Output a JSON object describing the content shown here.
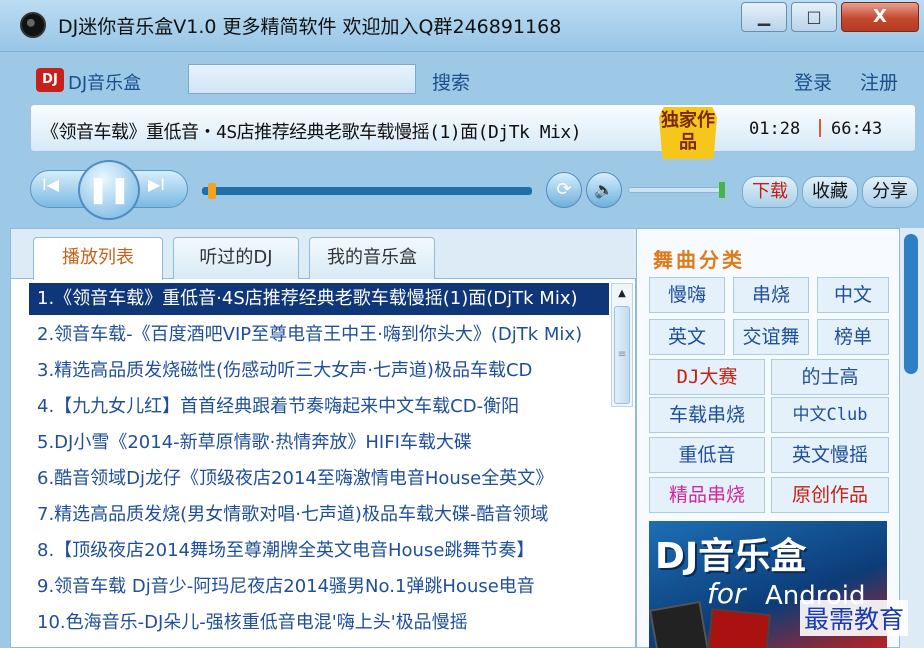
{
  "window": {
    "title": "DJ迷你音乐盒V1.0   更多精简软件 欢迎加入Q群246891168",
    "min": "▁",
    "max": "□",
    "close": "X"
  },
  "header": {
    "logo_badge": "DJ",
    "logo_text": "DJ音乐盒",
    "search_value": "",
    "search_label": "搜索",
    "login": "登录",
    "register": "注册"
  },
  "now_playing": {
    "title": "《领音车载》重低音・4S店推荐经典老歌车载慢摇(1)面(DjTk Mix)",
    "badge": "独家作品",
    "elapsed": "01:28",
    "total": "66:43",
    "progress": 0.02
  },
  "controls": {
    "prev": "I◀",
    "play": "❚❚",
    "next": "▶I",
    "loop": "⟳",
    "volume_icon": "🔈",
    "volume_level": 1.0,
    "download": "下载",
    "favorite": "收藏",
    "share": "分享"
  },
  "tabs": [
    "播放列表",
    "听过的DJ",
    "我的音乐盒"
  ],
  "playlist": [
    "1.《领音车载》重低音·4S店推荐经典老歌车载慢摇(1)面(DjTk Mix)",
    "2.领音车载-《百度酒吧VIP至尊电音王中王·嗨到你头大》(DjTk Mix)",
    "3.精选高品质发烧磁性(伤感动听三大女声·七声道)极品车载CD",
    "4.【九九女儿红】首首经典跟着节奏嗨起来中文车载CD-衡阳",
    "5.DJ小雪《2014-新草原情歌·热情奔放》HIFI车载大碟",
    "6.酷音领域Dj龙仔《顶级夜店2014至嗨激情电音House全英文》",
    "7.精选高品质发烧(男女情歌对唱·七声道)极品车载大碟-酷音领域",
    "8.【顶级夜店2014舞场至尊潮牌全英文电音House跳舞节奏】",
    "9.领音车载 Dj音少-阿玛尼夜店2014骚男No.1弹跳House电音",
    "10.色海音乐-DJ朵儿-强核重低音电混'嗨上头'极品慢摇"
  ],
  "categories": {
    "title": "舞曲分类",
    "row1": [
      "慢嗨",
      "串烧",
      "中文"
    ],
    "row2": [
      "英文",
      "交谊舞",
      "榜单"
    ],
    "row3": [
      "DJ大赛",
      "的士高"
    ],
    "row4": [
      "车载串烧",
      "中文Club"
    ],
    "row5": [
      "重低音",
      "英文慢摇"
    ],
    "row6": [
      "精品串烧",
      "原创作品"
    ],
    "highlight_colors": {
      "DJ大赛": "#c81d10",
      "精品串烧": "#d4269a",
      "原创作品": "#c81d10"
    }
  },
  "promo": {
    "title": "DJ音乐盒",
    "for": "for",
    "android": "Android"
  },
  "watermark": "最需教育"
}
